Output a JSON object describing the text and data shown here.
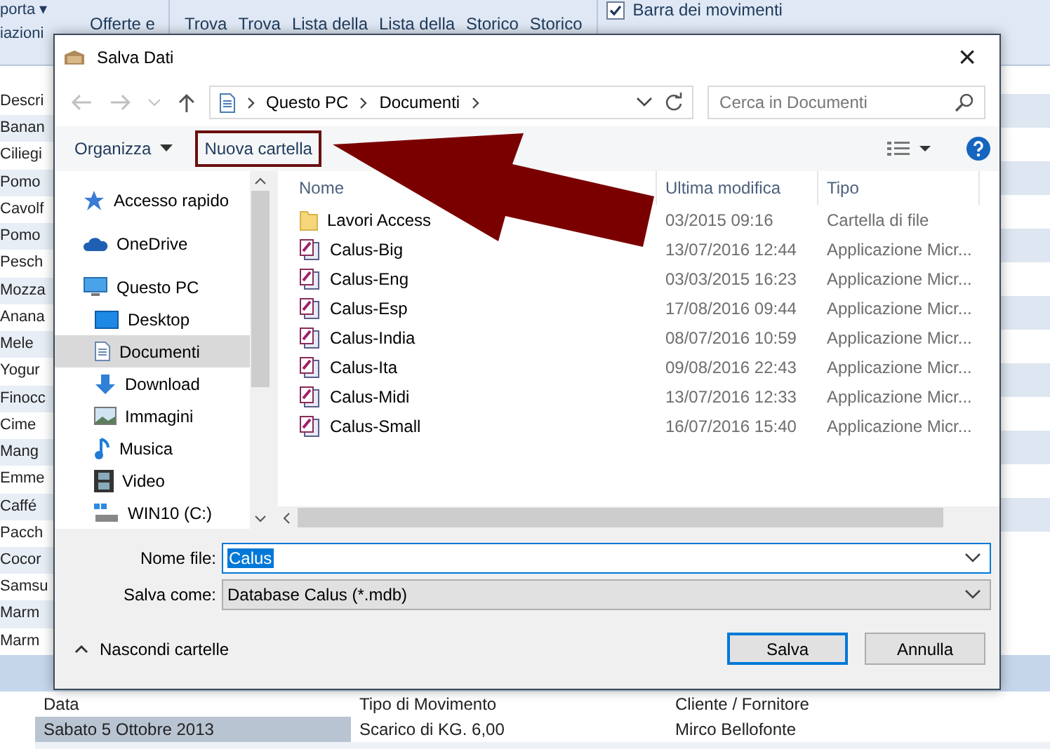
{
  "background_app": {
    "ribbon": {
      "items": [
        "porta ▾",
        "iazioni",
        "Offerte e",
        "Trova",
        "Trova",
        "Lista della",
        "Lista della",
        "Storico",
        "Storico"
      ],
      "checkbox": {
        "label": "Barra dei movimenti",
        "checked": true
      }
    },
    "list": {
      "header": "Descri",
      "rows": [
        "Banan",
        "Ciliegi",
        "Pomo",
        "Cavolf",
        "Pomo",
        "Pesch",
        "Mozza",
        "Anana",
        "Mele",
        "Yogur",
        "Finocc",
        "Cime",
        "Mang",
        "Emme",
        "Caffé",
        "Pacch",
        "Cocor",
        "Samsu",
        "Marm",
        "Marm"
      ]
    },
    "table": {
      "columns": [
        "Data",
        "Tipo di Movimento",
        "Cliente / Fornitore"
      ],
      "rows": [
        {
          "cells": [
            "Sabato  5 Ottobre 2013",
            "Scarico di KG. 6,00",
            "Mirco Bellofonte"
          ],
          "selected": true
        }
      ]
    }
  },
  "dialog": {
    "title": "Salva Dati",
    "close": "×",
    "breadcrumb": [
      "Questo PC",
      "Documenti"
    ],
    "search": {
      "placeholder": "Cerca in Documenti"
    },
    "toolbar": {
      "organize": "Organizza",
      "new_folder": "Nuova cartella"
    },
    "nav": [
      {
        "label": "Accesso rapido",
        "selected": false
      },
      {
        "label": "OneDrive",
        "selected": false
      },
      {
        "label": "Questo PC",
        "selected": false,
        "children": [
          {
            "label": "Desktop",
            "selected": false
          },
          {
            "label": "Documenti",
            "selected": true
          },
          {
            "label": "Download",
            "selected": false
          },
          {
            "label": "Immagini",
            "selected": false
          },
          {
            "label": "Musica",
            "selected": false
          },
          {
            "label": "Video",
            "selected": false
          },
          {
            "label": "WIN10 (C:)",
            "selected": false
          }
        ]
      }
    ],
    "file_table": {
      "columns": [
        "Nome",
        "Ultima modifica",
        "Tipo"
      ],
      "rows": [
        {
          "kind": "folder",
          "name": "Lavori Access",
          "modified": "03/2015 09:16",
          "type": "Cartella di file"
        },
        {
          "kind": "database",
          "name": "Calus-Big",
          "modified": "13/07/2016 12:44",
          "type": "Applicazione Micr..."
        },
        {
          "kind": "database",
          "name": "Calus-Eng",
          "modified": "03/03/2015 16:23",
          "type": "Applicazione Micr..."
        },
        {
          "kind": "database",
          "name": "Calus-Esp",
          "modified": "17/08/2016 09:44",
          "type": "Applicazione Micr..."
        },
        {
          "kind": "database",
          "name": "Calus-India",
          "modified": "08/07/2016 10:59",
          "type": "Applicazione Micr..."
        },
        {
          "kind": "database",
          "name": "Calus-Ita",
          "modified": "09/08/2016 22:43",
          "type": "Applicazione Micr..."
        },
        {
          "kind": "database",
          "name": "Calus-Midi",
          "modified": "13/07/2016 12:33",
          "type": "Applicazione Micr..."
        },
        {
          "kind": "database",
          "name": "Calus-Small",
          "modified": "16/07/2016 15:40",
          "type": "Applicazione Micr..."
        }
      ]
    },
    "file_name": {
      "label": "Nome file:",
      "value": "Calus"
    },
    "save_as": {
      "label": "Salva come:",
      "value": "Database Calus (*.mdb)"
    },
    "hide_folders": "Nascondi cartelle",
    "buttons": [
      "Salva",
      "Annulla"
    ]
  }
}
